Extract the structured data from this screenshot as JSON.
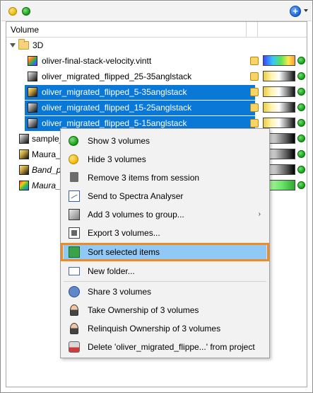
{
  "toolbar": {
    "add_label": "+"
  },
  "panel": {
    "column_header": "Volume"
  },
  "tree": {
    "folder": {
      "label": "3D",
      "icon": "folder-icon"
    },
    "items": [
      {
        "label": "oliver-final-stack-velocity.vintt",
        "icon": "velocity-volume-icon",
        "selected": false,
        "colorbar": "velocity"
      },
      {
        "label": "oliver_migrated_flipped_25-35anglstack",
        "icon": "seismic-volume-icon",
        "selected": false,
        "colorbar": "seismic"
      },
      {
        "label": "oliver_migrated_flipped_5-35anglstack",
        "icon": "seismic-volume-icon",
        "selected": true,
        "colorbar": "seismic"
      },
      {
        "label": "oliver_migrated_flipped_15-25anglstack",
        "icon": "seismic-volume-icon",
        "selected": true,
        "colorbar": "seismic"
      },
      {
        "label": "oliver_migrated_flipped_5-15anglstack",
        "icon": "seismic-volume-icon",
        "selected": true,
        "colorbar": "seismic"
      },
      {
        "label": "sample_",
        "icon": "seismic-volume-icon",
        "selected": false,
        "colorbar": "gray"
      },
      {
        "label": "Maura_2",
        "icon": "seismic-volume-icon",
        "selected": false,
        "colorbar": "gray"
      },
      {
        "label": "Band_pa",
        "icon": "seismic-volume-icon",
        "selected": false,
        "colorbar": "gray",
        "italic": true
      },
      {
        "label": "Maura_D",
        "icon": "multicolor-volume-icon",
        "selected": false,
        "colorbar": "green",
        "italic": true
      }
    ]
  },
  "context_menu": {
    "items": [
      {
        "label": "Show 3 volumes",
        "icon": "green-dot-icon"
      },
      {
        "label": "Hide 3 volumes",
        "icon": "yellow-dot-icon"
      },
      {
        "label": "Remove 3 items from session",
        "icon": "trash-icon"
      },
      {
        "label": "Send to Spectra Analyser",
        "icon": "spectra-icon"
      },
      {
        "label": "Add 3 volumes to group...",
        "icon": "group-icon",
        "submenu": true
      },
      {
        "label": "Export 3 volumes...",
        "icon": "export-icon"
      },
      {
        "label": "Sort selected items",
        "icon": "sort-icon",
        "highlighted": true
      },
      {
        "label": "New folder...",
        "icon": "new-folder-icon"
      },
      {
        "label": "Share 3 volumes",
        "icon": "share-icon"
      },
      {
        "label": "Take Ownership of 3 volumes",
        "icon": "take-ownership-icon"
      },
      {
        "label": "Relinquish Ownership of 3 volumes",
        "icon": "relinquish-ownership-icon"
      },
      {
        "label": "Delete 'oliver_migrated_flippe...' from project",
        "icon": "delete-from-project-icon"
      }
    ],
    "submenu_arrow": "›"
  },
  "colors": {
    "selection": "#0a78d7",
    "highlight_outline": "#f08a24",
    "highlight_fill": "#90c8f6"
  }
}
